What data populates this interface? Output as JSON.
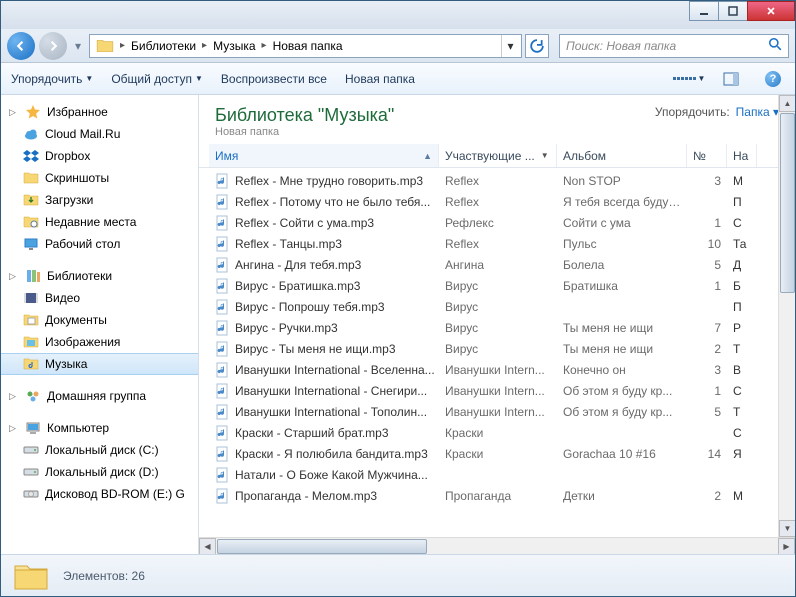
{
  "titlebar": {},
  "nav": {
    "crumbs": [
      "Библиотеки",
      "Музыка",
      "Новая папка"
    ],
    "search_placeholder": "Поиск: Новая папка"
  },
  "toolbar": {
    "organize": "Упорядочить",
    "share": "Общий доступ",
    "play_all": "Воспроизвести все",
    "new_folder": "Новая папка"
  },
  "sidebar": {
    "favorites": {
      "label": "Избранное",
      "items": [
        "Cloud Mail.Ru",
        "Dropbox",
        "Скриншоты",
        "Загрузки",
        "Недавние места",
        "Рабочий стол"
      ]
    },
    "libraries": {
      "label": "Библиотеки",
      "items": [
        "Видео",
        "Документы",
        "Изображения",
        "Музыка"
      ]
    },
    "homegroup": {
      "label": "Домашняя группа"
    },
    "computer": {
      "label": "Компьютер",
      "items": [
        "Локальный диск (C:)",
        "Локальный диск (D:)",
        "Дисковод BD-ROM (E:) G"
      ]
    }
  },
  "header": {
    "title": "Библиотека \"Музыка\"",
    "subtitle": "Новая папка",
    "organize": "Упорядочить:",
    "by": "Папка"
  },
  "columns": {
    "name": "Имя",
    "artist": "Участвующие ...",
    "album": "Альбом",
    "num": "№",
    "title": "На"
  },
  "files": [
    {
      "name": "Reflex - Мне трудно говорить.mp3",
      "artist": "Reflex",
      "album": "Non STOP",
      "num": "3",
      "t": "М"
    },
    {
      "name": "Reflex - Потому что не было тебя...",
      "artist": "Reflex",
      "album": "Я тебя всегда буду ...",
      "num": "",
      "t": "П"
    },
    {
      "name": "Reflex - Сойти с ума.mp3",
      "artist": "Рефлекс",
      "album": "Сойти с ума",
      "num": "1",
      "t": "С"
    },
    {
      "name": "Reflex - Танцы.mp3",
      "artist": "Reflex",
      "album": "Пульс",
      "num": "10",
      "t": "Та"
    },
    {
      "name": "Ангина - Для тебя.mp3",
      "artist": "Ангина",
      "album": "Болела",
      "num": "5",
      "t": "Д"
    },
    {
      "name": "Вирус - Братишка.mp3",
      "artist": "Вирус",
      "album": "Братишка",
      "num": "1",
      "t": "Б"
    },
    {
      "name": "Вирус - Попрошу тебя.mp3",
      "artist": "Вирус",
      "album": "",
      "num": "",
      "t": "П"
    },
    {
      "name": "Вирус - Ручки.mp3",
      "artist": "Вирус",
      "album": "Ты меня не ищи",
      "num": "7",
      "t": "Р"
    },
    {
      "name": "Вирус - Ты меня не ищи.mp3",
      "artist": "Вирус",
      "album": "Ты меня не ищи",
      "num": "2",
      "t": "Т"
    },
    {
      "name": "Иванушки International - Вселенна...",
      "artist": "Иванушки Intern...",
      "album": "Конечно он",
      "num": "3",
      "t": "В"
    },
    {
      "name": "Иванушки International - Снегири...",
      "artist": "Иванушки Intern...",
      "album": "Об этом я буду кр...",
      "num": "1",
      "t": "С"
    },
    {
      "name": "Иванушки International - Тополин...",
      "artist": "Иванушки Intern...",
      "album": "Об этом я буду кр...",
      "num": "5",
      "t": "Т"
    },
    {
      "name": "Краски - Старший брат.mp3",
      "artist": "Краски",
      "album": "",
      "num": "",
      "t": "С"
    },
    {
      "name": "Краски - Я полюбила бандита.mp3",
      "artist": "Краски",
      "album": "Gorachaa 10 #16",
      "num": "14",
      "t": "Я"
    },
    {
      "name": "Натали - О Боже Какой Мужчина...",
      "artist": "",
      "album": "",
      "num": "",
      "t": ""
    },
    {
      "name": "Пропаганда - Мелом.mp3",
      "artist": "Пропаганда",
      "album": "Детки",
      "num": "2",
      "t": "М"
    }
  ],
  "status": {
    "count_label": "Элементов: 26"
  }
}
